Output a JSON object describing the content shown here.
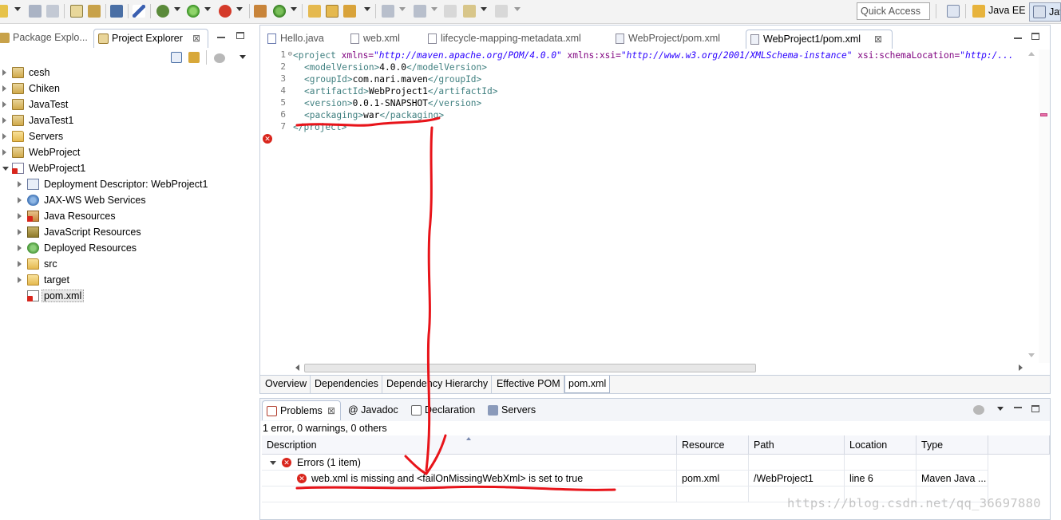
{
  "toolbar": {
    "quick_access_placeholder": "Quick Access",
    "perspectives": [
      "Java EE",
      "Java"
    ]
  },
  "explorer": {
    "tabs": [
      {
        "label": "Package Explo..."
      },
      {
        "label": "Project Explorer",
        "close": "⊠"
      }
    ],
    "tree": [
      {
        "label": "cesh",
        "icon": "project-icon",
        "level": 0,
        "expanded": false
      },
      {
        "label": "Chiken",
        "icon": "project-icon",
        "level": 0,
        "expanded": false
      },
      {
        "label": "JavaTest",
        "icon": "project-icon",
        "level": 0,
        "expanded": false
      },
      {
        "label": "JavaTest1",
        "icon": "project-icon",
        "level": 0,
        "expanded": false
      },
      {
        "label": "Servers",
        "icon": "folder-icon",
        "level": 0,
        "expanded": false
      },
      {
        "label": "WebProject",
        "icon": "project-icon",
        "level": 0,
        "expanded": false
      },
      {
        "label": "WebProject1",
        "icon": "project-error-icon",
        "level": 0,
        "expanded": true
      },
      {
        "label": "Deployment Descriptor: WebProject1",
        "icon": "deployment-descriptor-icon",
        "level": 1,
        "expanded": false
      },
      {
        "label": "JAX-WS Web Services",
        "icon": "web-services-icon",
        "level": 1,
        "expanded": false
      },
      {
        "label": "Java Resources",
        "icon": "java-resources-icon",
        "level": 1,
        "expanded": false
      },
      {
        "label": "JavaScript Resources",
        "icon": "javascript-resources-icon",
        "level": 1,
        "expanded": false
      },
      {
        "label": "Deployed Resources",
        "icon": "deployed-resources-icon",
        "level": 1,
        "expanded": false
      },
      {
        "label": "src",
        "icon": "folder-icon",
        "level": 1,
        "expanded": false
      },
      {
        "label": "target",
        "icon": "folder-icon",
        "level": 1,
        "expanded": false
      },
      {
        "label": "pom.xml",
        "icon": "xml-file-error-icon",
        "level": 1,
        "selected": true
      }
    ]
  },
  "editor": {
    "tabs": [
      {
        "label": "Hello.java",
        "active": false
      },
      {
        "label": "web.xml",
        "active": false
      },
      {
        "label": "lifecycle-mapping-metadata.xml",
        "active": false
      },
      {
        "label": "WebProject/pom.xml",
        "active": false
      },
      {
        "label": "WebProject1/pom.xml",
        "active": true
      }
    ],
    "line_numbers": [
      "1",
      "2",
      "3",
      "4",
      "5",
      "6",
      "7"
    ],
    "code": {
      "l1_open": "<project",
      "l1_a1": " xmlns=",
      "l1_v1": "\"http://maven.apache.org/POM/4.0.0\"",
      "l1_a2": " xmlns:xsi=",
      "l1_v2": "\"http://www.w3.org/2001/XMLSchema-instance\"",
      "l1_a3": " xsi:schemaLocation=",
      "l1_v3": "\"http:/...",
      "l2_open": "<modelVersion>",
      "l2_text": "4.0.0",
      "l2_close": "</modelVersion>",
      "l3_open": "<groupId>",
      "l3_text": "com.nari.maven",
      "l3_close": "</groupId>",
      "l4_open": "<artifactId>",
      "l4_text": "WebProject1",
      "l4_close": "</artifactId>",
      "l5_open": "<version>",
      "l5_text": "0.0.1-SNAPSHOT",
      "l5_close": "</version>",
      "l6_open": "<packaging>",
      "l6_text": "war",
      "l6_close": "</packaging>",
      "l7_close": "</project>"
    },
    "bottom_tabs": [
      "Overview",
      "Dependencies",
      "Dependency Hierarchy",
      "Effective POM",
      "pom.xml"
    ]
  },
  "problems": {
    "tabs": [
      "Problems",
      "@ Javadoc",
      "Declaration",
      "Servers"
    ],
    "summary": "1 error, 0 warnings, 0 others",
    "columns": [
      "Description",
      "Resource",
      "Path",
      "Location",
      "Type"
    ],
    "group_label": "Errors (1 item)",
    "rows": [
      {
        "description": "web.xml is missing and <failOnMissingWebXml> is set to true",
        "resource": "pom.xml",
        "path": "/WebProject1",
        "location": "line 6",
        "type": "Maven Java ..."
      }
    ]
  },
  "watermark": "https://blog.csdn.net/qq_36697880",
  "colors": {
    "xml_tag": "#3f7f7f",
    "xml_attribute": "#7f007f",
    "xml_value": "#2a00ff",
    "error": "#d9251c",
    "annotation_red": "#e8141a"
  }
}
